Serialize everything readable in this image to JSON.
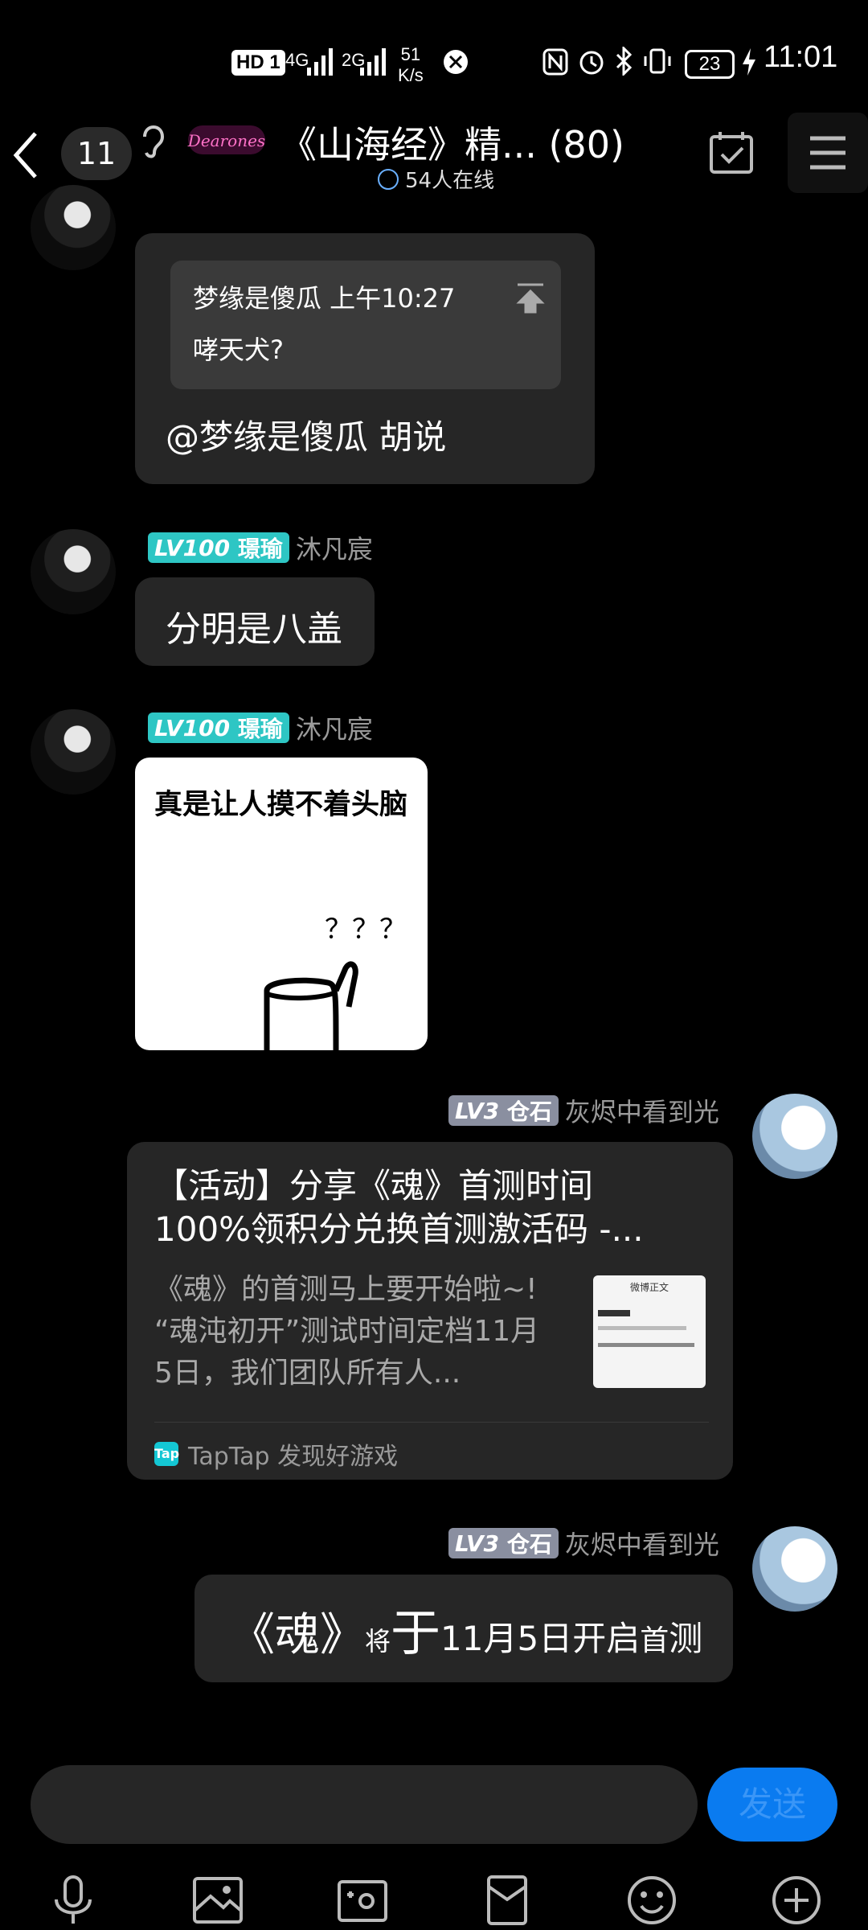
{
  "status_bar": {
    "hd": "HD 1",
    "network_1": "4G",
    "network_2": "2G",
    "speed_value": "51",
    "speed_unit": "K/s",
    "battery": "23",
    "time": "11:01"
  },
  "header": {
    "unread_count": "11",
    "logo_text": "Dearones",
    "title": "《山海经》精... (80)",
    "online": "54人在线"
  },
  "messages": {
    "m1": {
      "quote_header": "梦缘是傻瓜 上午10:27",
      "quote_text": "哮天犬?",
      "text": "@梦缘是傻瓜 胡说"
    },
    "m2": {
      "level": "LV100",
      "badge": "璟瑜",
      "nickname": "沐凡宸",
      "text": "分明是八盖"
    },
    "m3": {
      "level": "LV100",
      "badge": "璟瑜",
      "nickname": "沐凡宸",
      "image_caption": "真是让人摸不着头脑",
      "image_marks": "？？？"
    },
    "m4": {
      "level": "LV3",
      "badge": "仓石",
      "nickname": "灰烬中看到光",
      "card_title_1": "【活动】分享《魂》首测时间",
      "card_title_2": "100%领积分兑换首测激活码 -...",
      "card_desc_1": "《魂》的首测马上要开始啦~!",
      "card_desc_2": "“魂沌初开”测试时间定档11月",
      "card_desc_3": "5日，我们团队所有人...",
      "thumb_title": "微博正文",
      "source_logo": "Tap",
      "source": "TapTap 发现好游戏"
    },
    "m5": {
      "level": "LV3",
      "badge": "仓石",
      "nickname": "灰烬中看到光",
      "t1": "《魂》",
      "t2": "将",
      "t3": "于",
      "t4": "11月5日开启",
      "t5": "首",
      "t6": "测"
    }
  },
  "input": {
    "placeholder": "",
    "send_label": "发送"
  },
  "colors": {
    "level_100": "#2ec6c4",
    "level_3": "#8a8fa0",
    "send_button": "#0a7bf0",
    "bubble": "#262626"
  }
}
